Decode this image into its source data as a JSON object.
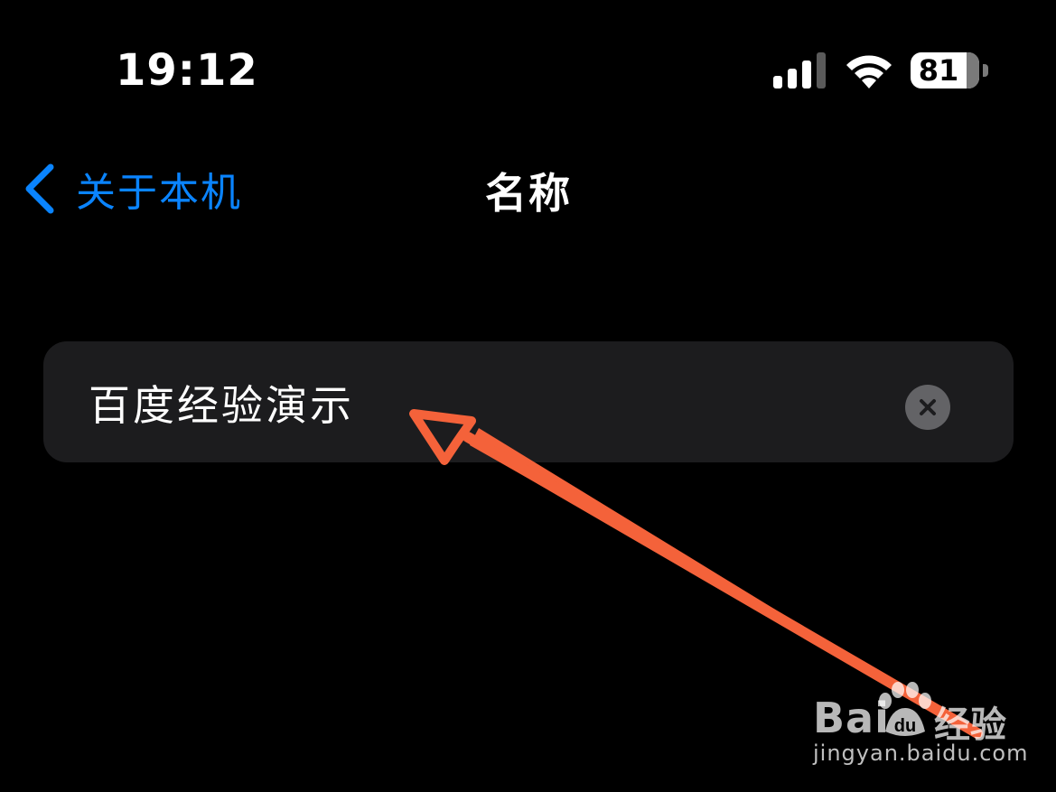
{
  "status_bar": {
    "time": "19:12",
    "battery_level": "81",
    "icons": {
      "signal": "cellular-signal-icon",
      "wifi": "wifi-icon",
      "battery": "battery-icon"
    }
  },
  "nav": {
    "back_label": "关于本机",
    "title": "名称",
    "back_icon": "chevron-left-icon"
  },
  "name_field": {
    "value": "百度经验演示",
    "clear_icon": "clear-circle-icon"
  },
  "colors": {
    "accent": "#0a84ff",
    "background": "#000000",
    "field_background": "#1c1c1e",
    "annotation": "#f4623a"
  },
  "watermark": {
    "brand_left": "Bai",
    "brand_right": "经验",
    "url": "jingyan.baidu.com"
  }
}
